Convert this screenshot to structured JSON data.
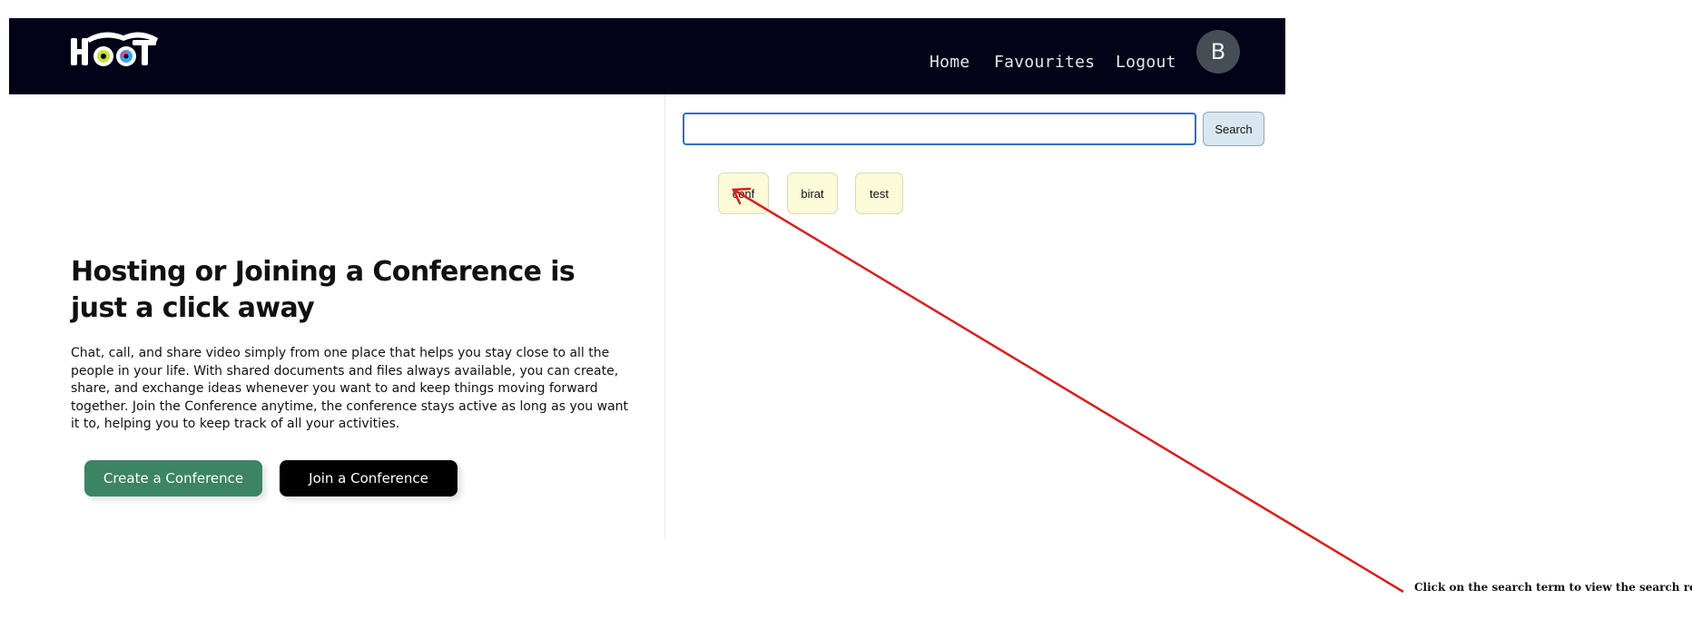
{
  "header": {
    "logo_text": "HOOT",
    "nav": {
      "home": "Home",
      "favourites": "Favourites",
      "logout": "Logout"
    },
    "avatar_initial": "B"
  },
  "hero": {
    "title": "Hosting or Joining a Conference is just a click away",
    "description": "Chat, call, and share video simply from one place that helps you stay close to all the people in your life. With shared documents and files always available, you can create, share, and exchange ideas whenever you want to and keep things moving forward together. Join the Conference anytime, the conference stays active as long as you want it to, helping you to keep track of all your activities.",
    "create_button": "Create a Conference",
    "join_button": "Join a Conference"
  },
  "search": {
    "input_value": "",
    "button_label": "Search",
    "terms": [
      "conf",
      "birat",
      "test"
    ]
  },
  "annotation": {
    "text": "Click on the search term to view the search results",
    "arrow_color": "#d81e1e"
  },
  "colors": {
    "navbar_bg": "#020318",
    "create_button_bg": "#3c8464",
    "join_button_bg": "#000000",
    "search_border": "#2f6cc8",
    "term_bg": "#fbfbd8"
  }
}
